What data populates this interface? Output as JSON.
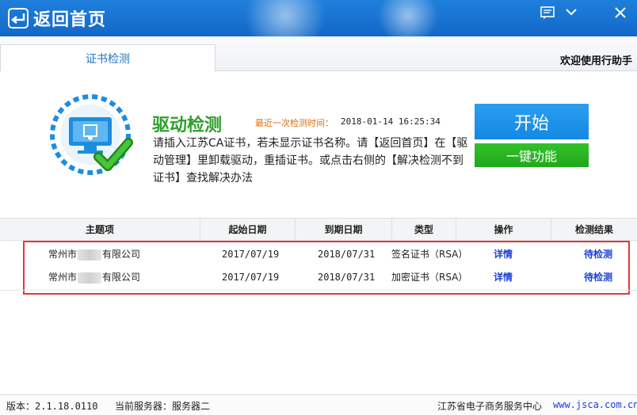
{
  "titlebar": {
    "back_label": "返回首页",
    "icons": [
      "message-icon",
      "minimize-icon",
      "close-icon"
    ]
  },
  "tabs": [
    {
      "label": "证书检测",
      "active": true
    }
  ],
  "welcome": "欢迎使用行助手",
  "driver_check": {
    "title": "驱动检测",
    "last_check_label": "最近一次检测时间：",
    "last_check_time": "2018-01-14 16:25:34",
    "instruction": "请插入江苏CA证书，若未显示证书名称。请【返回首页】在【驱动管理】里卸载驱动，重插证书。或点击右侧的【解决检测不到证书】查找解决办法",
    "start_label": "开始",
    "onekey_label": "一键功能"
  },
  "table": {
    "headers": [
      "主题项",
      "起始日期",
      "到期日期",
      "类型",
      "操作",
      "检测结果"
    ],
    "rows": [
      {
        "subject_prefix": "常州市",
        "subject_suffix": "有限公司",
        "start": "2017/07/19",
        "end": "2018/07/31",
        "type": "签名证书（RSA）",
        "action": "详情",
        "result": "待检测"
      },
      {
        "subject_prefix": "常州市",
        "subject_suffix": "有限公司",
        "start": "2017/07/19",
        "end": "2018/07/31",
        "type": "加密证书（RSA）",
        "action": "详情",
        "result": "待检测"
      }
    ]
  },
  "status": {
    "version": "版本：2.1.18.0110",
    "server": "当前服务器：服务器二",
    "org": "江苏省电子商务服务中心",
    "site": "www.jsca.com.cn"
  },
  "colors": {
    "titlebar": "#1f7fdc",
    "start_button": "#1588e3",
    "onekey_button": "#22a71c",
    "title_green": "#2ea02b",
    "link_blue": "#1a3fd6",
    "highlight_red": "#e8363a"
  }
}
